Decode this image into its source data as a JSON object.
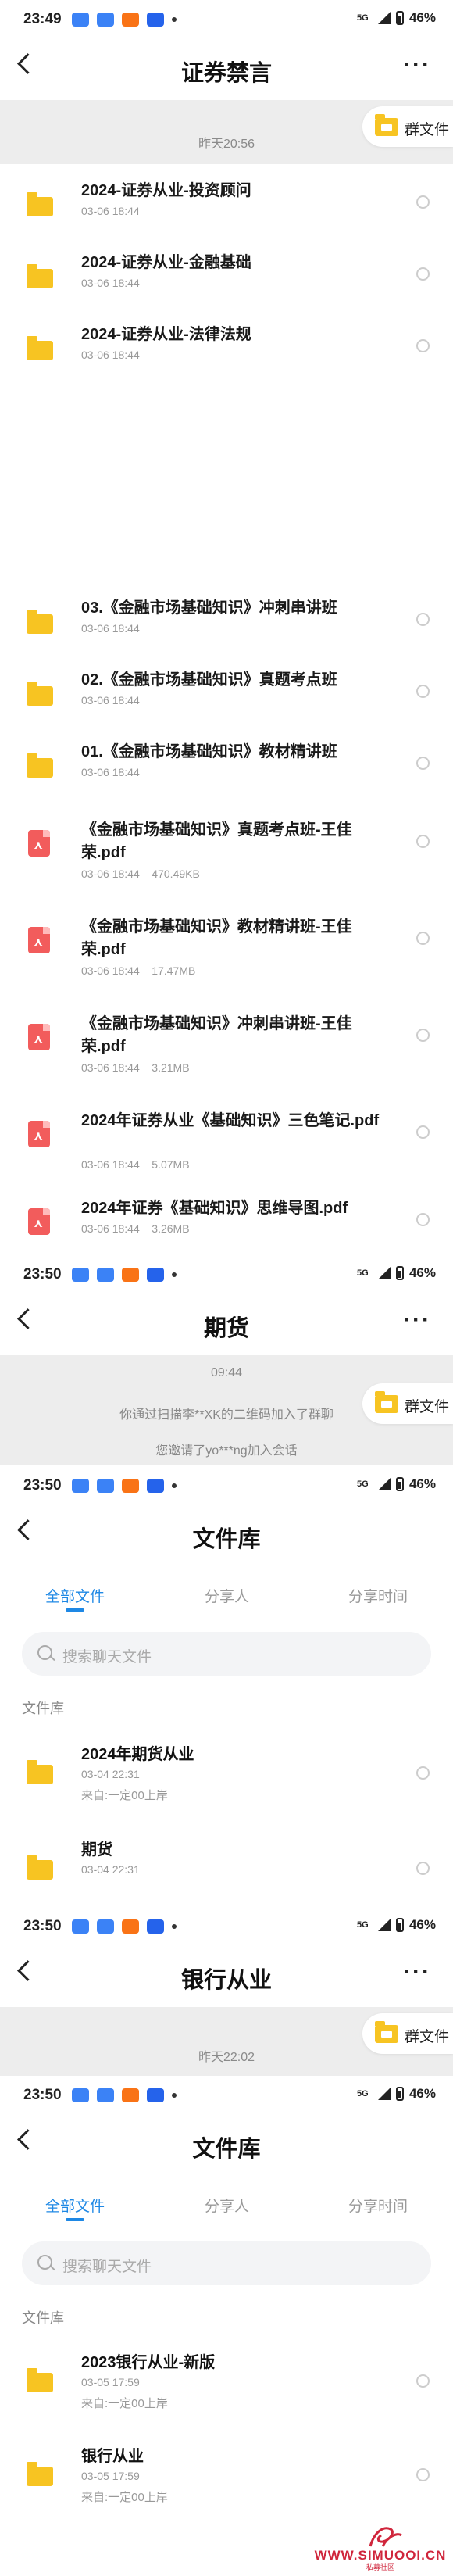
{
  "status_bars": [
    {
      "time": "23:49",
      "net": "5G",
      "battery": "46%"
    },
    {
      "time": "23:50",
      "net": "5G",
      "battery": "46%"
    },
    {
      "time": "23:50",
      "net": "5G",
      "battery": "46%"
    },
    {
      "time": "23:50",
      "net": "5G",
      "battery": "46%"
    },
    {
      "time": "23:50",
      "net": "5G",
      "battery": "46%"
    }
  ],
  "screen1": {
    "title": "证券禁言",
    "chat_time": "昨天20:56",
    "pill_label": "群文件",
    "files": [
      {
        "name": "2024-证券从业-投资顾问",
        "meta": "03-06 18:44"
      },
      {
        "name": "2024-证券从业-金融基础",
        "meta": "03-06 18:44"
      },
      {
        "name": "2024-证券从业-法律法规",
        "meta": "03-06 18:44"
      },
      {
        "name": "03.《金融市场基础知识》冲刺串讲班",
        "meta": "03-06 18:44"
      },
      {
        "name": "02.《金融市场基础知识》真题考点班",
        "meta": "03-06 18:44"
      },
      {
        "name": "01.《金融市场基础知识》教材精讲班",
        "meta": "03-06 18:44"
      },
      {
        "name": "《金融市场基础知识》真题考点班-王佳荣.pdf",
        "meta": "03-06 18:44    470.49KB"
      },
      {
        "name": "《金融市场基础知识》教材精讲班-王佳荣.pdf",
        "meta": "03-06 18:44    17.47MB"
      },
      {
        "name": "《金融市场基础知识》冲刺串讲班-王佳荣.pdf",
        "meta": "03-06 18:44    3.21MB"
      },
      {
        "name": "2024年证券从业《基础知识》三色笔记.pdf",
        "meta": "03-06 18:44    5.07MB"
      },
      {
        "name": "2024年证券《基础知识》思维导图.pdf",
        "meta": "03-06 18:44    3.26MB"
      }
    ]
  },
  "screen2": {
    "title": "期货",
    "chat_time": "09:44",
    "pill_label": "群文件",
    "sys1": "你通过扫描李**XK的二维码加入了群聊",
    "sys2": "您邀请了yo***ng加入会话"
  },
  "screen3": {
    "title": "文件库",
    "tabs": [
      "全部文件",
      "分享人",
      "分享时间"
    ],
    "search_placeholder": "搜索聊天文件",
    "section": "文件库",
    "items": [
      {
        "name": "2024年期货从业",
        "meta": "03-04 22:31",
        "from": "来自:一定00上岸"
      },
      {
        "name": "期货",
        "meta": "03-04 22:31",
        "from": ""
      }
    ]
  },
  "screen4": {
    "title": "银行从业",
    "chat_time": "昨天22:02",
    "pill_label": "群文件"
  },
  "screen5": {
    "title": "文件库",
    "tabs": [
      "全部文件",
      "分享人",
      "分享时间"
    ],
    "search_placeholder": "搜索聊天文件",
    "section": "文件库",
    "items": [
      {
        "name": "2023银行从业-新版",
        "meta": "03-05 17:59",
        "from": "来自:一定00上岸"
      },
      {
        "name": "银行从业",
        "meta": "03-05 17:59",
        "from": "来自:一定00上岸"
      }
    ]
  },
  "watermark": {
    "text": "WWW.SIMUOOI.CN",
    "sub": "私募社区"
  },
  "colors": {
    "accent": "#1e88e5",
    "folder": "#f7c422",
    "pdf": "#f25c5c",
    "chat_bg": "#ededed"
  }
}
